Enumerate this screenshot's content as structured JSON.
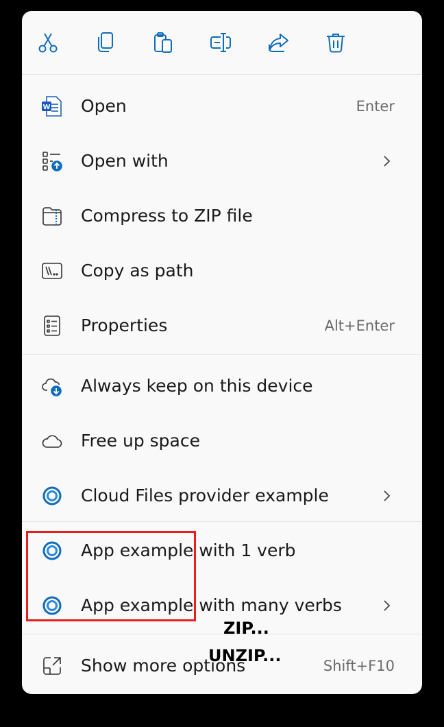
{
  "toolbar": {
    "buttons": [
      {
        "name": "cut-button",
        "icon": "scissors-icon"
      },
      {
        "name": "copy-button",
        "icon": "copy-icon"
      },
      {
        "name": "paste-button",
        "icon": "paste-icon"
      },
      {
        "name": "rename-button",
        "icon": "rename-icon"
      },
      {
        "name": "share-button",
        "icon": "share-icon"
      },
      {
        "name": "delete-button",
        "icon": "trash-icon"
      }
    ]
  },
  "items": {
    "open": {
      "label": "Open",
      "shortcut": "Enter",
      "icon": "word-document-icon"
    },
    "open_with": {
      "label": "Open with",
      "icon": "open-with-icon"
    },
    "compress": {
      "label": "Compress to ZIP file",
      "icon": "zip-folder-icon"
    },
    "copy_path": {
      "label": "Copy as path",
      "icon": "copy-path-icon"
    },
    "properties": {
      "label": "Properties",
      "shortcut": "Alt+Enter",
      "icon": "properties-icon"
    },
    "always_keep": {
      "label": "Always keep on this device",
      "icon": "cloud-download-icon"
    },
    "free_up": {
      "label": "Free up space",
      "icon": "cloud-icon"
    },
    "cloud_files": {
      "label": "Cloud Files provider example",
      "icon": "app-ring-icon"
    },
    "app_one_verb": {
      "label": "App example with 1 verb",
      "icon": "app-ring-icon"
    },
    "app_many_verbs": {
      "label": "App example with many verbs",
      "icon": "app-ring-icon"
    },
    "show_more": {
      "label": "Show more options",
      "shortcut": "Shift+F10",
      "icon": "show-more-icon"
    }
  },
  "overlay": {
    "zip": "ZIP...",
    "unzip": "UNZIP..."
  },
  "colors": {
    "accent": "#0f6cbd",
    "highlight_border": "#e81d1d",
    "menu_bg": "#f9f9f9"
  }
}
